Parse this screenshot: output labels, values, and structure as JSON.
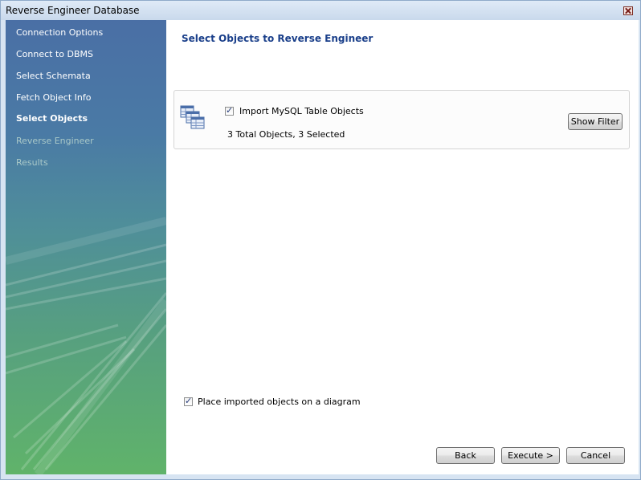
{
  "window": {
    "title": "Reverse Engineer Database"
  },
  "steps": [
    {
      "label": "Connection Options",
      "state": "done"
    },
    {
      "label": "Connect to DBMS",
      "state": "done"
    },
    {
      "label": "Select Schemata",
      "state": "done"
    },
    {
      "label": "Fetch Object Info",
      "state": "done"
    },
    {
      "label": "Select Objects",
      "state": "active"
    },
    {
      "label": "Reverse Engineer",
      "state": "pending"
    },
    {
      "label": "Results",
      "state": "pending"
    }
  ],
  "main": {
    "heading": "Select Objects to Reverse Engineer",
    "import_panel": {
      "icon": "table-objects-icon",
      "checkbox_label": "Import MySQL Table Objects",
      "checked": true,
      "summary": "3 Total Objects, 3 Selected",
      "filter_button": "Show Filter"
    },
    "place_on_diagram": {
      "label": "Place imported objects on a diagram",
      "checked": true
    }
  },
  "footer": {
    "back": "Back",
    "execute": "Execute >",
    "cancel": "Cancel"
  }
}
